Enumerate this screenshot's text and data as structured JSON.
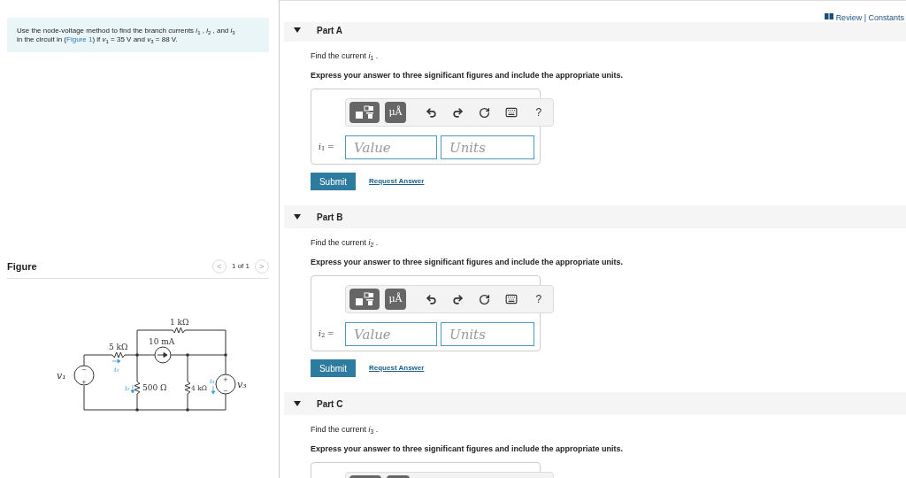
{
  "problem": {
    "before": "Use the node-voltage method to find the branch currents *i*$_{1}$ , *i*$_{2}$ , and *i*$_{3}$ in the circuit in (",
    "link": "Figure 1",
    "after": ") if *v*$_{1}$ = 35 V and *v*$_{3}$ = 88 V."
  },
  "figure": {
    "title": "Figure",
    "pager": "1 of 1",
    "prev": "<",
    "next": ">",
    "labels": {
      "r_top": "1 kΩ",
      "source": "10 mA",
      "r_left": "5 kΩ",
      "r_mid": "500 Ω",
      "r_right": "4 kΩ",
      "v_left": "v₁",
      "v_right": "v₃",
      "i_1": "i₁",
      "i_2": "i₂",
      "i_3": "i₃",
      "plus": "+",
      "minus": "−"
    }
  },
  "review_link": "Review | Constants",
  "parts": [
    {
      "label": "Part A",
      "expanded": true,
      "prompt": "Find the current *i*$_{1}$ .",
      "instruction": "Express your answer to three significant figures and include the appropriate units.",
      "answer": {
        "units_button": "μÅ",
        "help": "?",
        "variable": "*i*$_{1}$ =",
        "value_placeholder": "Value",
        "units_placeholder": "Units"
      },
      "submit": "Submit",
      "request": "Request Answer"
    },
    {
      "label": "Part B",
      "expanded": true,
      "prompt": "Find the current *i*$_{2}$ .",
      "instruction": "Express your answer to three significant figures and include the appropriate units.",
      "answer": {
        "units_button": "μÅ",
        "help": "?",
        "variable": "*i*$_{2}$ =",
        "value_placeholder": "Value",
        "units_placeholder": "Units"
      },
      "submit": "Submit",
      "request": "Request Answer"
    },
    {
      "label": "Part C",
      "expanded": true,
      "prompt": "Find the current *i*$_{3}$ .",
      "instruction": "Express your answer to three significant figures and include the appropriate units."
    }
  ]
}
